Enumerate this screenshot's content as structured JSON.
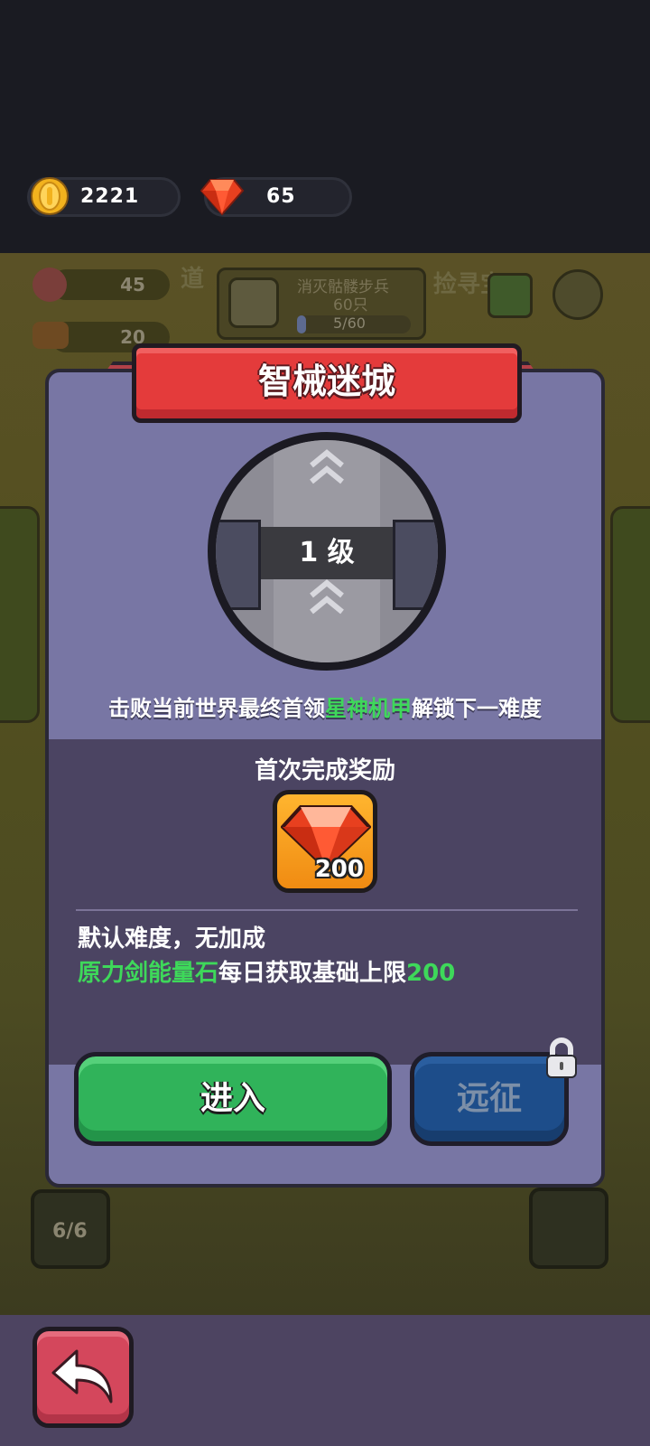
{
  "currency": {
    "coins": "2221",
    "gems": "65"
  },
  "background": {
    "meat": "45",
    "wood": "20",
    "quest_title": "消灭骷髅步兵",
    "quest_count": "60只",
    "quest_progress": "5/60",
    "quest_progress_fraction": 0.083,
    "left_tab": "道",
    "right_tab": "捡寻宝",
    "squad_count": "6/6"
  },
  "dialog": {
    "title": "智械迷城",
    "level_label": "1 级",
    "hint_prefix": "击败当前世界最终首领",
    "hint_boss": "星神机甲",
    "hint_suffix": "解锁下一难度",
    "reward_title": "首次完成奖励",
    "reward_count": "200",
    "difficulty_text": "默认难度，无加成",
    "limit_item": "原力剑能量石",
    "limit_text": "每日获取基础上限",
    "limit_value": "200",
    "enter_label": "进入",
    "expedition_label": "远征",
    "expedition_locked": true
  },
  "colors": {
    "ribbon": "#e43b3b",
    "enter_button": "#30b35a",
    "expedition_button": "#1d4d8a",
    "highlight": "#3ed85a",
    "dialog_bg": "#7876a4"
  }
}
